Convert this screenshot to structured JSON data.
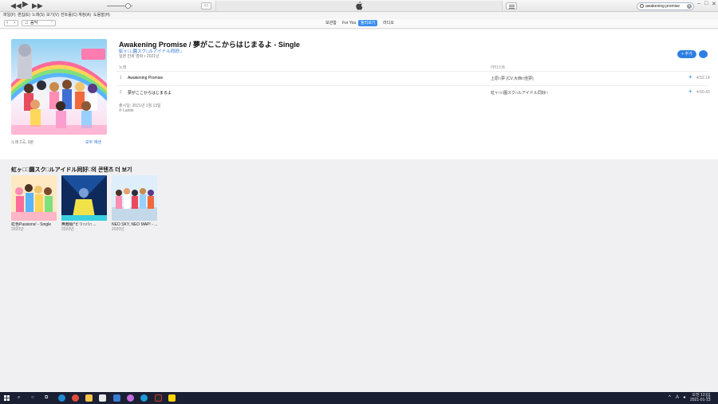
{
  "search": {
    "query": "awakening promise"
  },
  "menu": [
    "파일(F)",
    "편집(E)",
    "노래(S)",
    "보기(V)",
    "컨트롤(C)",
    "계정(A)",
    "도움말(H)"
  ],
  "nav": {
    "media": "음악",
    "tabs": [
      "보관함",
      "For You",
      "둘러보기",
      "라디오"
    ],
    "active_tab": "둘러보기"
  },
  "album": {
    "title": "Awakening Promise / 夢がここからはじまるよ - Single",
    "artist": "虹ヶ□□園スク□ルアイドル同好□",
    "meta": "일본 만화 영화 • 2021년",
    "add_label": "+ 추가",
    "columns": {
      "song": "노래",
      "artist": "아티스트"
    },
    "tracks": [
      {
        "num": "1",
        "name": "Awakening Promise",
        "artist": "上原□夢 (CV.大西□佳夢)",
        "duration": "4:52.14"
      },
      {
        "num": "2",
        "name": "夢がここからはじまるよ",
        "artist": "虹ヶ□□園スク□ルアイドル同好□",
        "duration": "4:50.43"
      }
    ],
    "release": "출시일: 2021년 1월 13일",
    "label": "℗ Lantis",
    "song_count": "노래 2곡, 9분",
    "library_link": "모두 재생"
  },
  "more": {
    "title": "虹ヶ□□園スク□ルアイドル同好□의 콘텐츠 더 보기",
    "items": [
      {
        "title": "虹色Passions! - Single",
        "year": "2020년"
      },
      {
        "title": "無敵級*ビリ□バ□ ...",
        "year": "2020년"
      },
      {
        "title": "NEO SKY, NEO MAP! - ...",
        "year": "2020년"
      }
    ]
  },
  "tray": {
    "ime": "A",
    "time": "오전 12:01",
    "date": "2021-01-13"
  },
  "colors": {
    "accent": "#3a8ff0",
    "link": "#2a6fd6",
    "taskbar": "#1b1f33"
  }
}
